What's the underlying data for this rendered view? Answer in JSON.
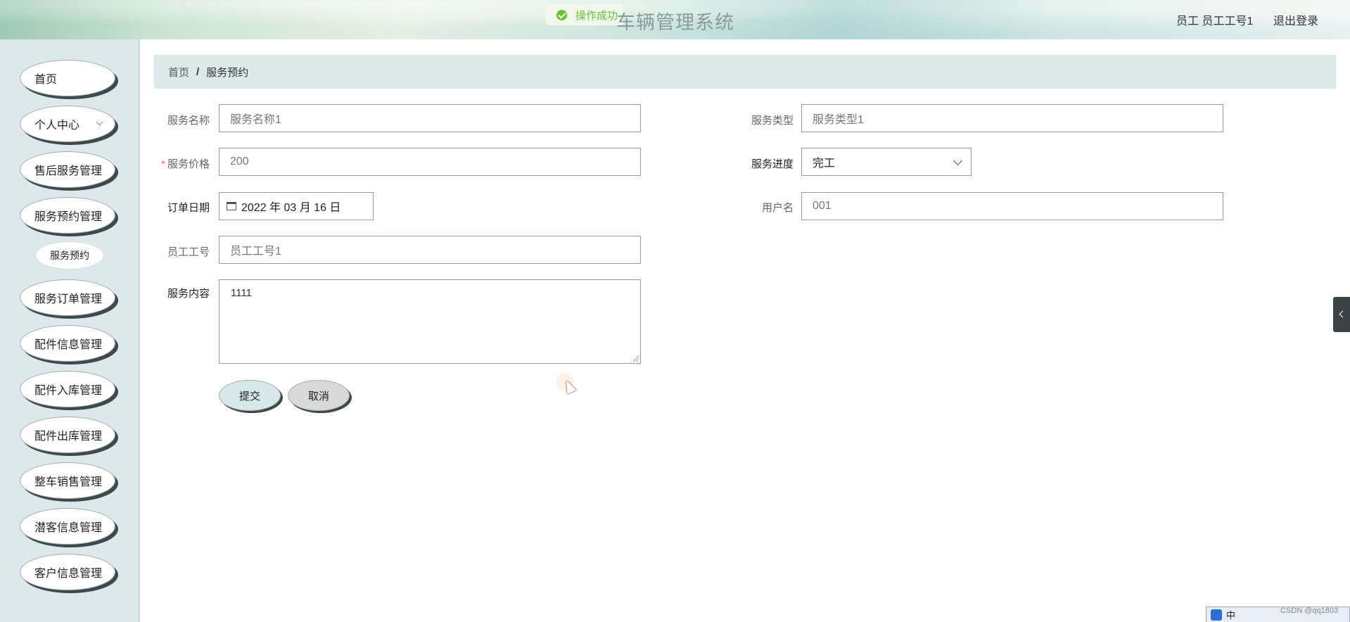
{
  "header": {
    "app_title": "车辆管理系统",
    "toast": "操作成功",
    "user_info": "员工  员工工号1",
    "logout": "退出登录"
  },
  "sidebar": {
    "items": [
      {
        "label": "首页"
      },
      {
        "label": "个人中心"
      },
      {
        "label": "售后服务管理"
      },
      {
        "label": "服务预约管理"
      },
      {
        "label": "服务订单管理"
      },
      {
        "label": "配件信息管理"
      },
      {
        "label": "配件入库管理"
      },
      {
        "label": "配件出库管理"
      },
      {
        "label": "整车销售管理"
      },
      {
        "label": "潜客信息管理"
      },
      {
        "label": "客户信息管理"
      }
    ],
    "sub_item": "服务预约"
  },
  "breadcrumb": {
    "home": "首页",
    "separator": "/",
    "current": "服务预约"
  },
  "form": {
    "service_name": {
      "label": "服务名称",
      "value": "服务名称1"
    },
    "service_type": {
      "label": "服务类型",
      "value": "服务类型1"
    },
    "service_price": {
      "label": "服务价格",
      "required_mark": "*",
      "value": "200"
    },
    "service_progress": {
      "label": "服务进度",
      "value": "完工"
    },
    "order_date": {
      "label": "订单日期",
      "value": "2022 年 03 月 16 日"
    },
    "username": {
      "label": "用户名",
      "value": "001"
    },
    "employee_no": {
      "label": "员工工号",
      "value": "员工工号1"
    },
    "service_content": {
      "label": "服务内容",
      "value": "1111"
    },
    "submit": "提交",
    "cancel": "取消"
  },
  "tray": {
    "ime": "中",
    "watermark": "CSDN @qq1803"
  },
  "colors": {
    "sidebar_bg": "#dce9ea",
    "breadcrumb_bg": "#dce9e9",
    "submit_bg": "#d7e7ea",
    "cancel_bg": "#d9d9d9",
    "toast_green": "#67c23a"
  }
}
